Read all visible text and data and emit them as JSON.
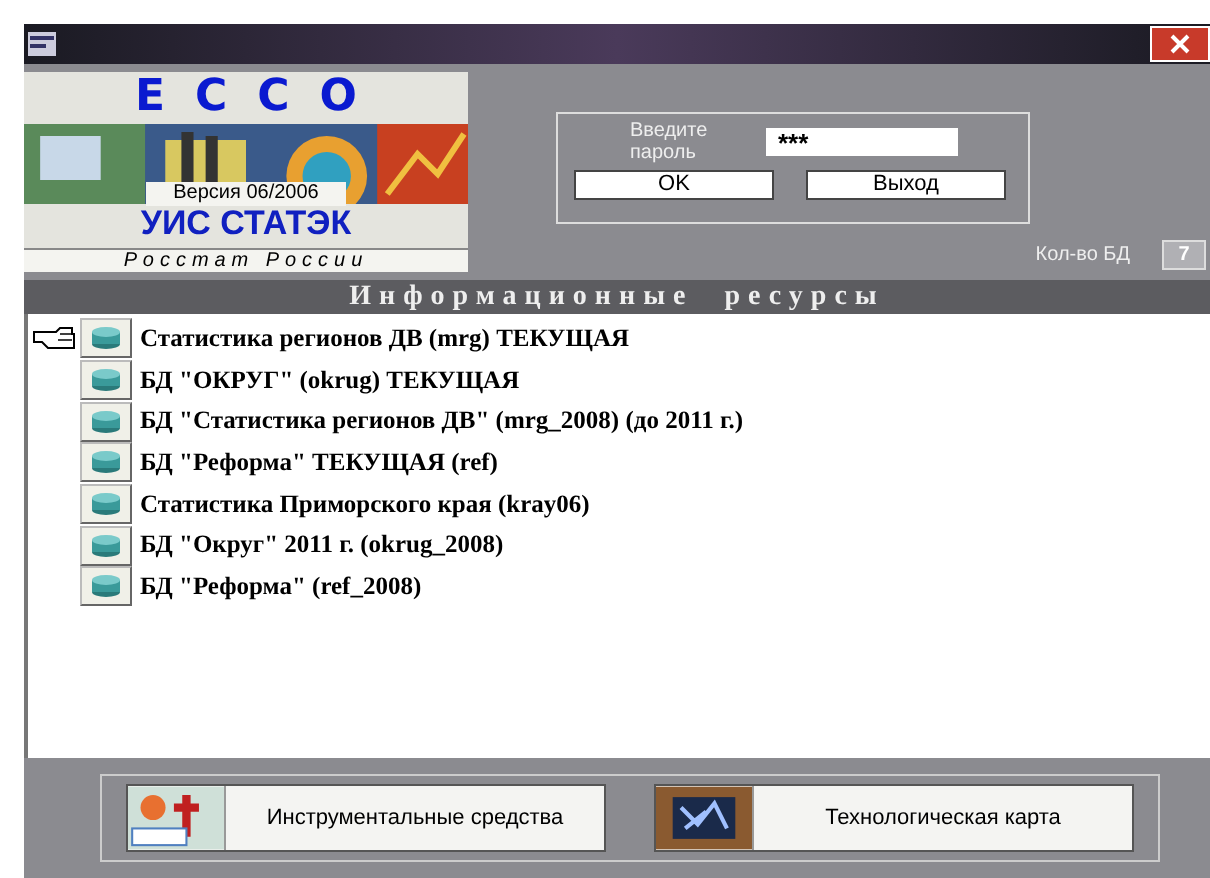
{
  "logo": {
    "title": "ECCO",
    "version": "Версия 06/2006",
    "product": "УИС СТАТЭК",
    "org": "Росстат России"
  },
  "login": {
    "label": "Введите пароль",
    "value": "***",
    "buttons": [
      "OK",
      "Выход"
    ]
  },
  "db_count": {
    "label": "Кол-во БД",
    "value": "7"
  },
  "resources": {
    "title": "Информационные ресурсы",
    "items": [
      {
        "label": "Статистика регионов ДВ (mrg) ТЕКУЩАЯ",
        "selected": true
      },
      {
        "label": "БД \"ОКРУГ\" (okrug) ТЕКУЩАЯ",
        "selected": false
      },
      {
        "label": "БД \"Статистика регионов ДВ\" (mrg_2008) (до 2011 г.)",
        "selected": false
      },
      {
        "label": "БД \"Реформа\" ТЕКУЩАЯ (ref)",
        "selected": false
      },
      {
        "label": "Статистика Приморского края (kray06)",
        "selected": false
      },
      {
        "label": "БД \"Округ\" 2011 г. (okrug_2008)",
        "selected": false
      },
      {
        "label": "БД \"Реформа\" (ref_2008)",
        "selected": false
      }
    ]
  },
  "tools": [
    {
      "label": "Инструментальные средства",
      "kind": "tools"
    },
    {
      "label": "Технологическая карта",
      "kind": "map"
    }
  ]
}
